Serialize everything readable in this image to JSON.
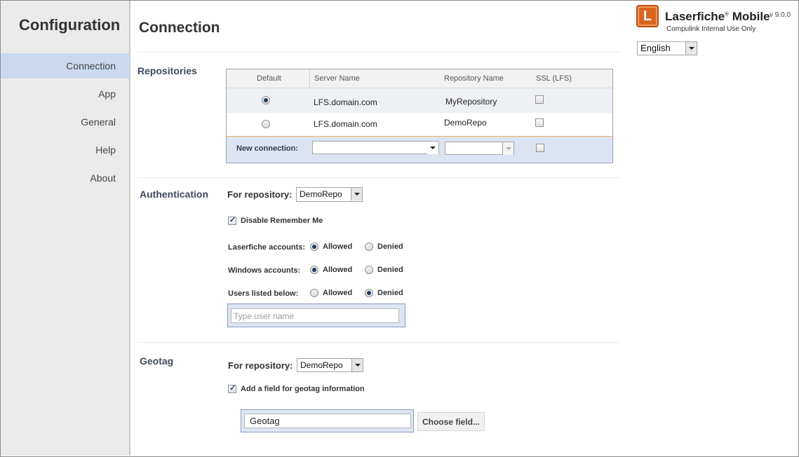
{
  "sidebar": {
    "title": "Configuration",
    "items": [
      {
        "label": "Connection"
      },
      {
        "label": "App"
      },
      {
        "label": "General"
      },
      {
        "label": "Help"
      },
      {
        "label": "About"
      }
    ]
  },
  "brand": {
    "logo_letter": "L",
    "name": "Laserfiche",
    "trademark": "®",
    "product": "Mobile",
    "version": "v 9.0.0",
    "subtitle": "Compulink Internal Use Only"
  },
  "language": {
    "selected": "English"
  },
  "page": {
    "title": "Connection"
  },
  "repositories": {
    "label": "Repositories",
    "columns": [
      "Default",
      "Server Name",
      "Repository Name",
      "SSL (LFS)"
    ],
    "rows": [
      {
        "server": "LFS.domain.com",
        "repository": "MyRepository",
        "default": true,
        "ssl": false
      },
      {
        "server": "LFS.domain.com",
        "repository": "DemoRepo",
        "default": false,
        "ssl": false
      }
    ],
    "new_connection_label": "New connection:",
    "new_server_value": "",
    "new_repo_value": ""
  },
  "authentication": {
    "label": "Authentication",
    "for_repository_label": "For repository:",
    "repository": "DemoRepo",
    "disable_remember_me": "Disable Remember Me",
    "disable_remember_me_checked": true,
    "allowed_label": "Allowed",
    "denied_label": "Denied",
    "rules": [
      {
        "label": "Laserfiche accounts:",
        "value": "Allowed"
      },
      {
        "label": "Windows accounts:",
        "value": "Allowed"
      },
      {
        "label": "Users listed below:",
        "value": "Denied"
      }
    ],
    "user_placeholder": "Type user name"
  },
  "geotag": {
    "label": "Geotag",
    "for_repository_label": "For repository:",
    "repository": "DemoRepo",
    "add_field_label": "Add a field for geotag information",
    "add_field_checked": true,
    "field_value": "Geotag",
    "choose_button": "Choose field..."
  }
}
